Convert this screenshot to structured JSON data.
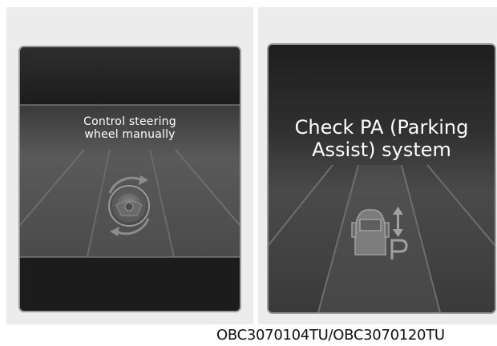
{
  "left_display": {
    "line1": "Control steering",
    "line2": "wheel manually",
    "icon": "steering-wheel-rotate-icon"
  },
  "right_display": {
    "line1": "Check PA (Parking",
    "line2": "Assist) system",
    "icon": "car-parking-assist-icon"
  },
  "caption": "OBC3070104TU/OBC3070120TU"
}
